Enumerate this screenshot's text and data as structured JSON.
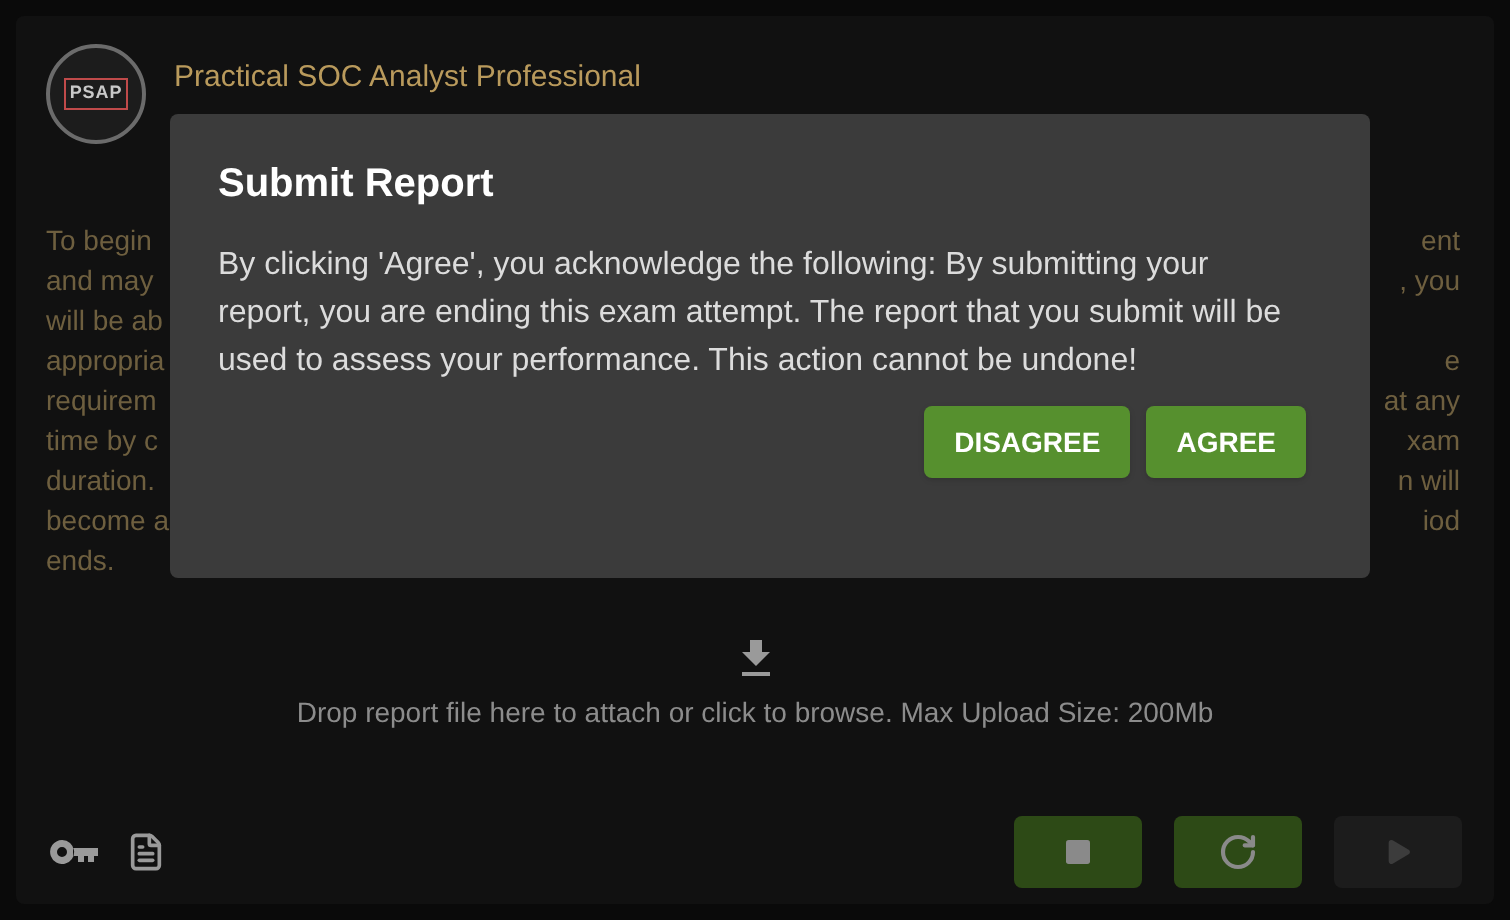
{
  "exam": {
    "logo_text": "PSAP",
    "title": "Practical SOC Analyst Professional"
  },
  "instructions_lines": [
    {
      "left": "To begin",
      "right": "ent"
    },
    {
      "left": "and may",
      "right": ", you"
    },
    {
      "left": "will be ab"
    },
    {
      "left": "appropria",
      "right": "e"
    },
    {
      "left": "requirem",
      "right": "at any"
    },
    {
      "left": "time by c",
      "right": "xam"
    },
    {
      "left": "duration.",
      "right": "n will"
    },
    {
      "left": "become a",
      "right": "iod"
    },
    {
      "left": "ends."
    }
  ],
  "upload": {
    "text": "Drop report file here to attach or click to browse. Max Upload Size: 200Mb"
  },
  "controls": [
    {
      "kind": "stop",
      "disabled": false
    },
    {
      "kind": "restart",
      "disabled": false
    },
    {
      "kind": "play",
      "disabled": true
    }
  ],
  "dialog": {
    "title": "Submit Report",
    "message": "By clicking 'Agree', you acknowledge the following: By submitting your report, you are ending this exam attempt. The report that you submit will be used to assess your performance. This action cannot be undone!",
    "buttons": [
      "DISAGREE",
      "AGREE"
    ]
  }
}
